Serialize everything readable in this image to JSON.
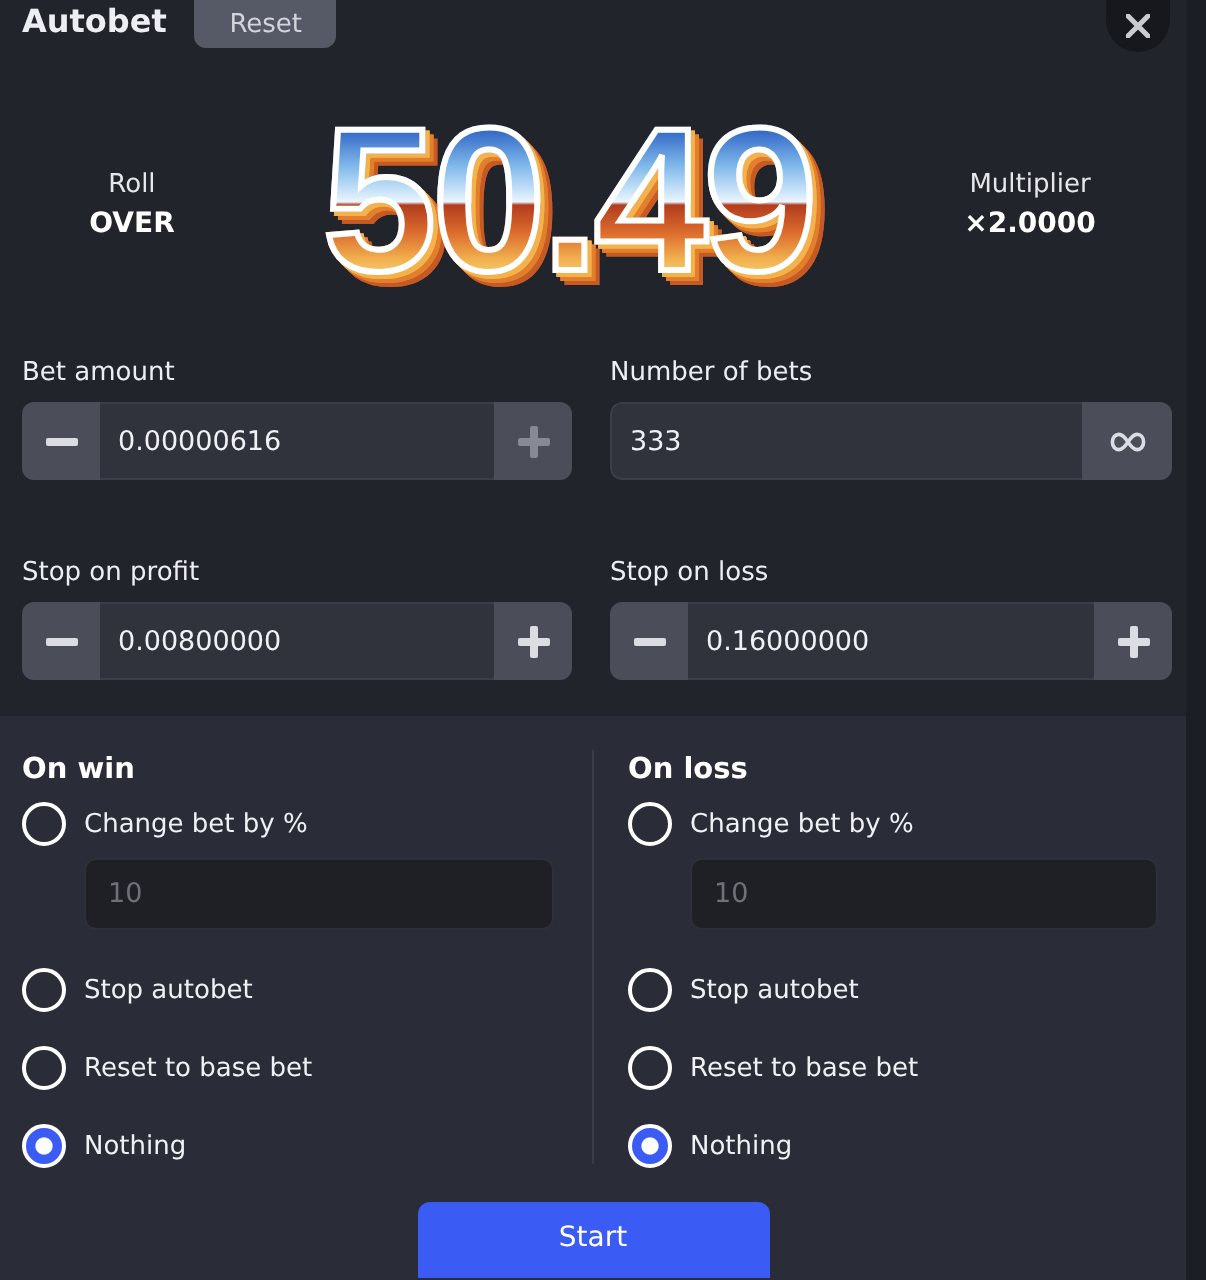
{
  "header": {
    "title": "Autobet",
    "reset_button": "Reset"
  },
  "hero": {
    "roll_label": "Roll",
    "roll_value": "OVER",
    "result": "50.49",
    "multiplier_label": "Multiplier",
    "multiplier_value": "×2.0000"
  },
  "fields": [
    {
      "label": "Bet amount",
      "value": "0.00000616",
      "kind": "stepper",
      "increase_disabled": true
    },
    {
      "label": "Number of bets",
      "value": "333",
      "kind": "infinite"
    },
    {
      "label": "Stop on profit",
      "value": "0.00800000",
      "kind": "stepper",
      "increase_disabled": false
    },
    {
      "label": "Stop on loss",
      "value": "0.16000000",
      "kind": "stepper",
      "increase_disabled": false
    }
  ],
  "strategies": [
    {
      "title": "On win",
      "options": [
        {
          "label": "Change bet by %",
          "kind": "percent",
          "selected": false,
          "value": "10",
          "disabled": true
        },
        {
          "label": "Stop autobet",
          "kind": "plain",
          "selected": false
        },
        {
          "label": "Reset to base bet",
          "kind": "plain",
          "selected": false
        },
        {
          "label": "Nothing",
          "kind": "plain",
          "selected": true
        }
      ]
    },
    {
      "title": "On loss",
      "options": [
        {
          "label": "Change bet by %",
          "kind": "percent",
          "selected": false,
          "value": "10",
          "disabled": true
        },
        {
          "label": "Stop autobet",
          "kind": "plain",
          "selected": false
        },
        {
          "label": "Reset to base bet",
          "kind": "plain",
          "selected": false
        },
        {
          "label": "Nothing",
          "kind": "plain",
          "selected": true
        }
      ]
    }
  ],
  "start_button": "Start"
}
